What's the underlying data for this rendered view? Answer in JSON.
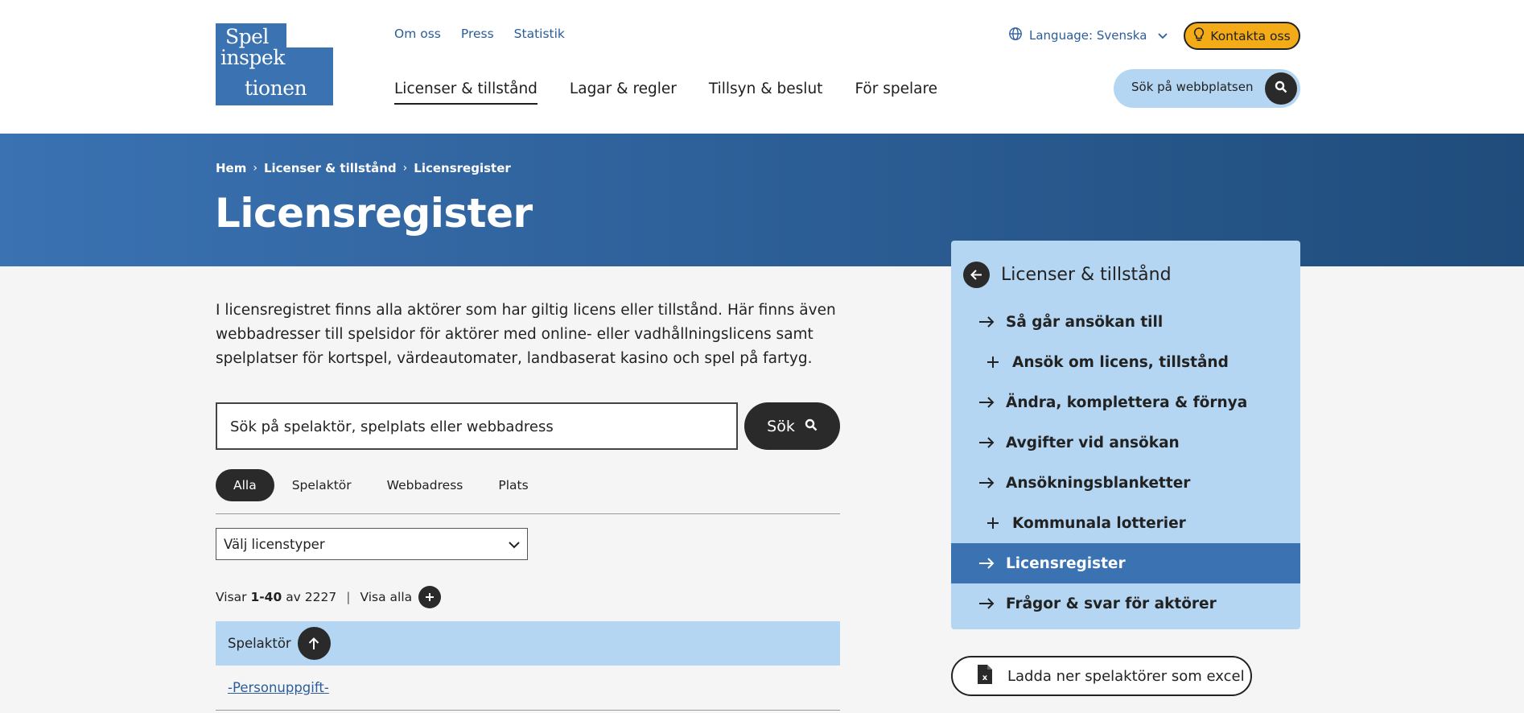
{
  "header": {
    "logo_text": [
      "Spel",
      "inspek",
      "tionen"
    ],
    "top_links": [
      "Om oss",
      "Press",
      "Statistik"
    ],
    "main_nav": [
      "Licenser & tillstånd",
      "Lagar & regler",
      "Tillsyn & beslut",
      "För spelare"
    ],
    "language": "Language: Svenska",
    "contact": "Kontakta oss",
    "search_placeholder": "Sök på webbplatsen"
  },
  "breadcrumb": [
    "Hem",
    "Licenser & tillstånd",
    "Licensregister"
  ],
  "page_title": "Licensregister",
  "intro": "I licensregistret finns alla aktörer som har giltig licens eller tillstånd. Här finns även webbadresser till spelsidor för aktörer med online- eller vadhållningslicens samt spelplatser för kortspel, värdeautomater, landbaserat kasino och spel på fartyg.",
  "search": {
    "placeholder": "Sök på spelaktör, spelplats eller webbadress",
    "button": "Sök"
  },
  "filters": [
    "Alla",
    "Spelaktör",
    "Webbadress",
    "Plats"
  ],
  "license_select": "Välj licenstyper",
  "results": {
    "prefix": "Visar",
    "range": "1-40",
    "of": "av",
    "total": "2227",
    "show_all": "Visa alla"
  },
  "table": {
    "header": "Spelaktör",
    "rows": [
      "-Personuppgift-"
    ]
  },
  "sidenav": {
    "title": "Licenser & tillstånd",
    "items": [
      {
        "label": "Så går ansökan till",
        "icon": "arrow-right-icon"
      },
      {
        "label": "Ansök om licens, tillstånd",
        "icon": "plus-icon"
      },
      {
        "label": "Ändra, komplettera & förnya",
        "icon": "arrow-right-icon"
      },
      {
        "label": "Avgifter vid ansökan",
        "icon": "arrow-right-icon"
      },
      {
        "label": "Ansökningsblanketter",
        "icon": "arrow-right-icon"
      },
      {
        "label": "Kommunala lotterier",
        "icon": "plus-icon"
      },
      {
        "label": "Licensregister",
        "icon": "arrow-right-icon"
      },
      {
        "label": "Frågor & svar för aktörer",
        "icon": "arrow-right-icon"
      }
    ]
  },
  "download_button": "Ladda ner spelaktörer som excel",
  "colors": {
    "brand_blue": "#3a72b2",
    "light_blue": "#b4d6f2",
    "contact_yellow": "#f3ab18",
    "dark": "#2a2a2a"
  }
}
